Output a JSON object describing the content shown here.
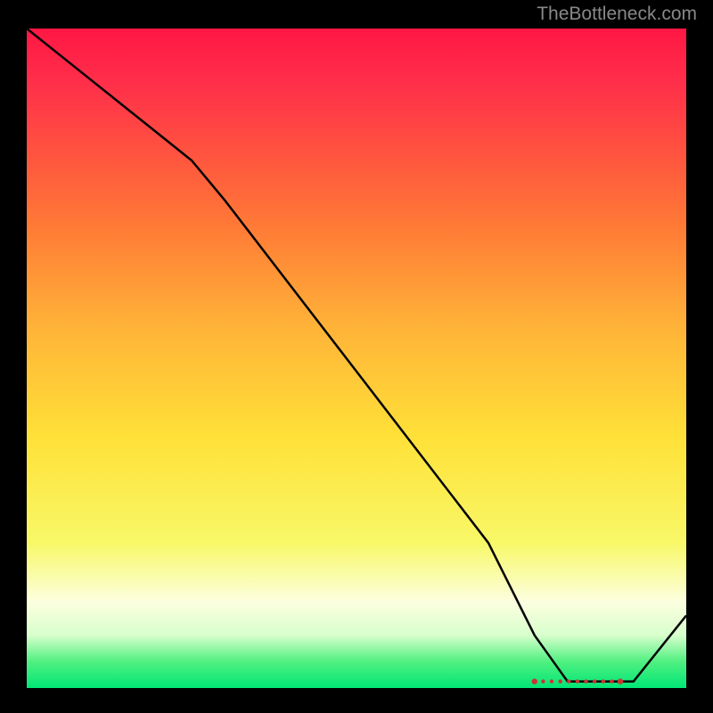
{
  "attribution": "TheBottleneck.com",
  "chart_data": {
    "type": "line",
    "title": "",
    "xlabel": "",
    "ylabel": "",
    "xlim": [
      0,
      100
    ],
    "ylim": [
      0,
      100
    ],
    "series": [
      {
        "name": "bottleneck-curve",
        "x": [
          0,
          10,
          20,
          25,
          30,
          40,
          50,
          60,
          70,
          77,
          82,
          88,
          92,
          100
        ],
        "y": [
          100,
          92,
          84,
          80,
          74,
          61,
          48,
          35,
          22,
          8,
          1,
          1,
          1,
          11
        ]
      }
    ],
    "markers": {
      "name": "optimal-range",
      "x_start": 77,
      "x_end": 90,
      "y": 1
    },
    "colors": {
      "gradient_top": "#ff1744",
      "gradient_mid1": "#ff9028",
      "gradient_mid2": "#ffe138",
      "gradient_bottom": "#00e676",
      "line": "#000000",
      "marker": "#cc3333"
    }
  }
}
